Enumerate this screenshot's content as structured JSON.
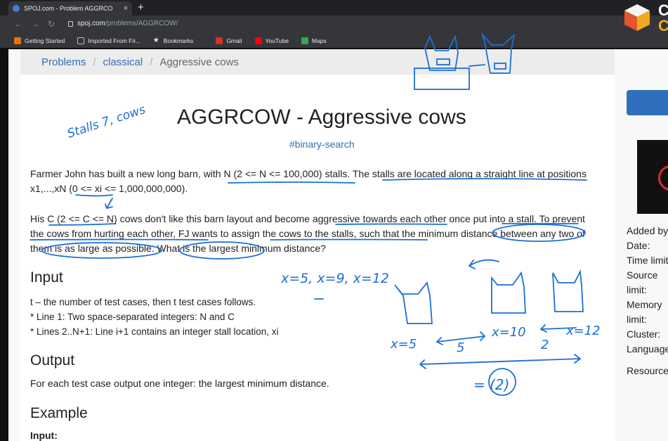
{
  "browser": {
    "tab_title": "SPOJ.com - Problem AGGRCO",
    "tab_close": "×",
    "new_tab": "+",
    "url_host": "spoj.com",
    "url_path": "/problems/AGGRCOW/",
    "bookmarks": [
      {
        "label": "Getting Started",
        "color": "#e8710a"
      },
      {
        "label": "Imported From Fir...",
        "color": "#9aa0a6"
      },
      {
        "label": "Bookmarks",
        "color": "#e8eaed"
      },
      {
        "label": "Gmail",
        "color": "#d93025"
      },
      {
        "label": "YouTube",
        "color": "#ff0000"
      },
      {
        "label": "Maps",
        "color": "#34a853"
      }
    ]
  },
  "breadcrumb": {
    "problems": "Problems",
    "classical": "classical",
    "current": "Aggressive cows",
    "separator": "/"
  },
  "problem": {
    "title": "AGGRCOW - Aggressive cows",
    "tag": "#binary-search",
    "para1": "Farmer John has built a new long barn, with N (2 <= N <= 100,000) stalls. The stalls are located along a straight line at positions x1,...,xN (0 <= xi <= 1,000,000,000).",
    "para2": "His C (2 <= C <= N) cows don't like this barn layout and become aggressive towards each other once put into a stall. To prevent the cows from hurting each other, FJ wants to assign the cows to the stalls, such that the minimum distance between any two of them is as large as possible. What is the largest minimum distance?",
    "input_heading": "Input",
    "input_line1": "t – the number of test cases, then t test cases follows.",
    "input_line2": "* Line 1: Two space-separated integers: N and C",
    "input_line3": "* Lines 2..N+1: Line i+1 contains an integer stall location, xi",
    "output_heading": "Output",
    "output_text": "For each test case output one integer: the largest minimum distance.",
    "example_heading": "Example",
    "input_label": "Input:"
  },
  "sidebar": {
    "meta_labels": [
      "Added by:",
      "Date:",
      "Time limit:",
      "Source limit:",
      "Memory limit:",
      "Cluster:",
      "Languages:"
    ],
    "resource_label": "Resource:"
  },
  "overlay_logo": {
    "line1": "C",
    "line2": "C"
  },
  "annotations": {
    "stalls_note": "Stalls 7, cows",
    "positions": "x=5, x=9, x=12",
    "x5": "x=5",
    "gap5": "5",
    "x10": "x=10",
    "x12": "x=12",
    "gap2": "2",
    "answer": "= (2)",
    "ink_color": "#1b6fd6"
  }
}
